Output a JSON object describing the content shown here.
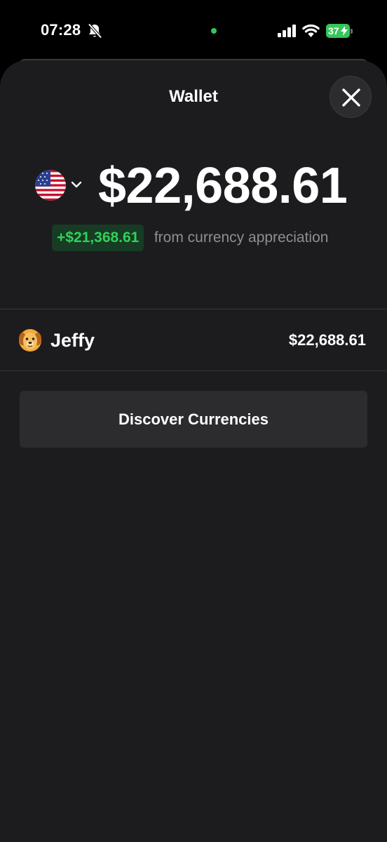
{
  "status_bar": {
    "time": "07:28",
    "battery_level": "37",
    "icons": [
      "bell-slash-icon",
      "signal-icon",
      "wifi-icon",
      "battery-charging-icon"
    ],
    "colors": {
      "battery": "#34c759",
      "camera_indicator": "#33c75a"
    }
  },
  "sheet": {
    "title": "Wallet",
    "close_icon": "close-icon"
  },
  "summary": {
    "currency_icon": "us-flag-icon",
    "selector_icon": "chevron-down-icon",
    "balance": "$22,688.61",
    "gain": "+$21,368.61",
    "gain_caption": "from currency appreciation",
    "colors": {
      "gain_text": "#30d158",
      "gain_background": "#173b24"
    }
  },
  "wallets": [
    {
      "avatar_icon": "dog-face-icon",
      "name": "Jeffy",
      "amount": "$22,688.61"
    }
  ],
  "discover_button": {
    "label": "Discover Currencies"
  }
}
